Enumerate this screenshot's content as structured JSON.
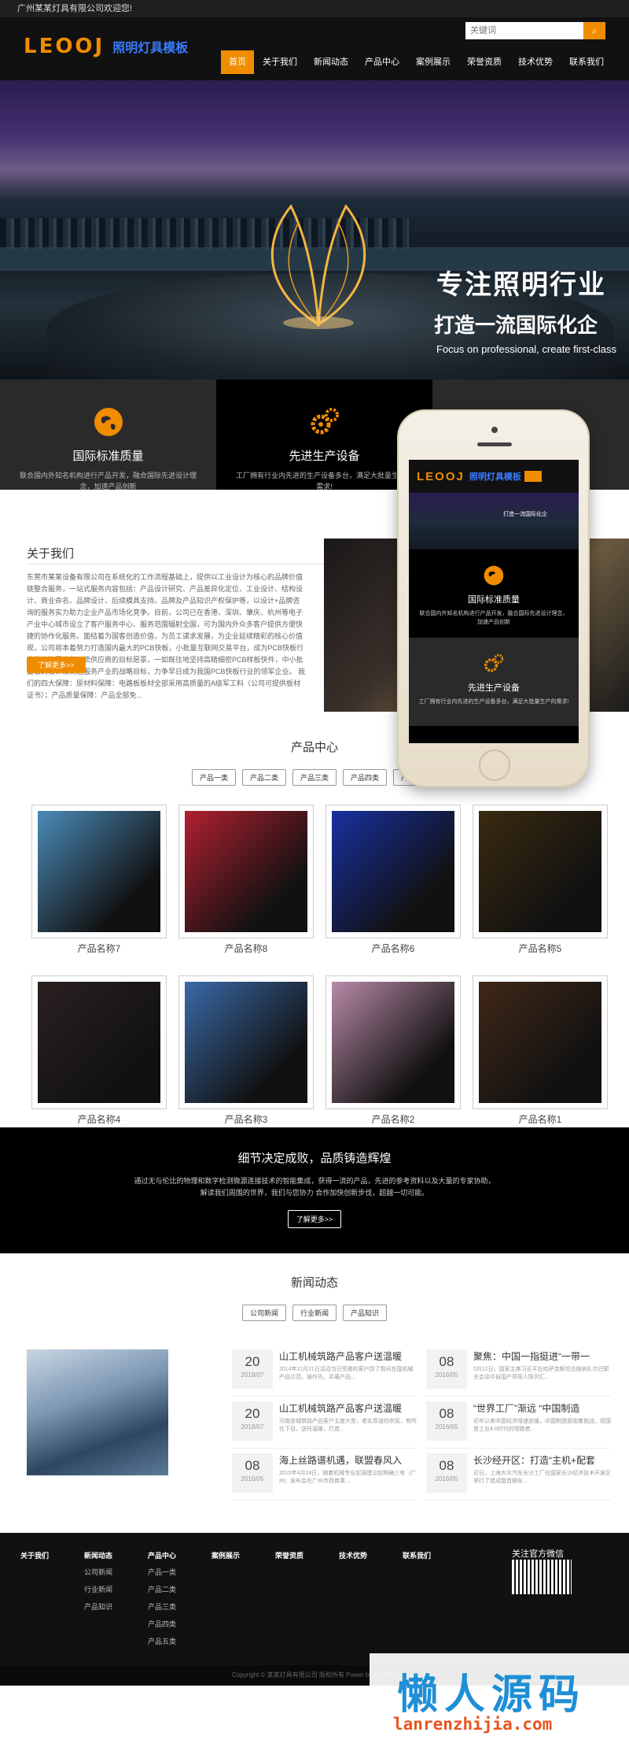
{
  "topbar": {
    "welcome": "广州某某灯具有限公司欢迎您!"
  },
  "header": {
    "logo_mark": "LEOOJ",
    "logo_text": "照明灯具模板",
    "search_placeholder": "关键词",
    "search_icon": "search-icon",
    "nav": [
      "首页",
      "关于我们",
      "新闻动态",
      "产品中心",
      "案例展示",
      "荣誉资质",
      "技术优势",
      "联系我们"
    ],
    "active_nav": "首页"
  },
  "banner": {
    "line1": "专注照明行业",
    "line2": "打造一流国际化企",
    "line3": "Focus on professional, create first-class"
  },
  "features": [
    {
      "title": "国际标准质量",
      "desc": "联合国内外知名机构进行产品开发，融合国际先进设计理念，加速产品创新",
      "icon": "globe-icon"
    },
    {
      "title": "先进生产设备",
      "desc": "工厂拥有行业内先进的生产设备多台，满足大批量生产的需求!",
      "icon": "gears-icon"
    },
    {
      "title": "",
      "desc": "",
      "icon": ""
    }
  ],
  "about": {
    "title": "关于我们",
    "text": "东莞市某某设备有限公司在系统化的工作流程基础上，提供以工业设计为核心的品牌价值链整合服务，一站式服务内容包括：产品设计研究、产品差异化定位、工业设计、结构设计、商业命名、品牌设计、后续模具支持。品牌及产品知识产权保护等，以设计+品牌咨询的服务实力助力企业产品市场化竞争。目前，公司已在香港、深圳、肇庆、杭州等电子产业中心城市设立了客户服务中心、服务范围辐射全国，可为国内外众多客户提供方便快捷的协作化服务。面结着为国客创造价值，为员工谋求发展，为企业延续精彩的核心价值观，公司将本着努力打造国内最大的PCB快板，小批量互联网交易平台，成为PCB快板行业性价比最高的一流供应商的目标愿景，一如既往地坚持高精细密PCB样板快件，中小批量板的设计及制造服务产业的战略目标，力争早日成为我国PCB快板行业的领军企业。 我们的四大保障：原材料保障：电路板板材全部采用高质量的A级军工料（公司可提供板材证书）；产品质量保障：产品全部免...",
    "more": "了解更多>>"
  },
  "phone": {
    "logo_mark": "LEOOJ",
    "logo_text": "照明灯具模板",
    "banner_text": "打造一流国际化企",
    "features": [
      {
        "title": "国际标准质量",
        "desc": "联合国内外知名机构进行产品开发，融合国际先进设计理念，加速产品创新"
      },
      {
        "title": "先进生产设备",
        "desc": "工厂拥有行业内先进的生产设备多台，满足大批量生产的需求!"
      }
    ]
  },
  "products": {
    "title": "产品中心",
    "tabs": [
      "产品一类",
      "产品二类",
      "产品三类",
      "产品四类",
      "产品五类"
    ],
    "items": [
      {
        "name": "产品名称7",
        "tone": "#4a8bb8"
      },
      {
        "name": "产品名称8",
        "tone": "#b02030"
      },
      {
        "name": "产品名称6",
        "tone": "#1830a0"
      },
      {
        "name": "产品名称5",
        "tone": "#3a2a10"
      },
      {
        "name": "产品名称4",
        "tone": "#2a2020"
      },
      {
        "name": "产品名称3",
        "tone": "#3a6aa8"
      },
      {
        "name": "产品名称2",
        "tone": "#b88aa8"
      },
      {
        "name": "产品名称1",
        "tone": "#402818"
      }
    ]
  },
  "culture": {
    "title": "细节决定成败，品质铸造辉煌",
    "text": "通过无与伦比的物理和数字检测微源连接技术的智能集成，获得一流的产品，先进的参考资料以及大量的专家协助，解读我们周围的世界，我们与您协力 合作加快创新步伐，超越一切可能。",
    "more": "了解更多>>"
  },
  "news": {
    "title": "新闻动态",
    "tabs": [
      "公司新闻",
      "行业新闻",
      "产品知识"
    ],
    "left": [
      {
        "day": "20",
        "ym": "2018/07",
        "title": "山工机械筑路产品客户送温暖",
        "summary": "2014年11月21日活动当日受邀的客户到了我司在国机械产品示范，操作先，并展产品..."
      },
      {
        "day": "20",
        "ym": "2018/07",
        "title": "山工机械筑路产品客户送温暖",
        "summary": "河南浙城筑路产品客户主度大型，老实厚道的农民，有所在下目，送托温暖，打造..."
      },
      {
        "day": "08",
        "ym": "2016/05",
        "title": "海上丝路谱机遇，联盟春风入",
        "summary": "2015年4月24日，随着机械专业起源建议起明确三有（广州）发布会在广州市西商事..."
      }
    ],
    "right": [
      {
        "day": "08",
        "ym": "2016/05",
        "title": "聚焦：中国一指挺进“一带一",
        "summary": "5月12日，国家主席习近平在哈萨克斯坦总统纳扎尔巴耶夫会谈中自国产领导人陈列汇..."
      },
      {
        "day": "08",
        "ym": "2016/05",
        "title": "“世界工厂”渐远 “中国制造",
        "summary": "近年以来中国经济增速放缓，中国制造面临着挑战，德国是工业4.0时代的领跑者..."
      },
      {
        "day": "08",
        "ym": "2016/05",
        "title": "长沙经开区：打造“主机+配套",
        "summary": "近日，上海大众汽车长沙工厂在国家长沙经济技术开发区举行了建成暨首辆车..."
      }
    ]
  },
  "footer": {
    "cols": [
      {
        "head": "关于我们",
        "links": []
      },
      {
        "head": "新闻动态",
        "links": [
          "公司新闻",
          "行业新闻",
          "产品知识"
        ]
      },
      {
        "head": "产品中心",
        "links": [
          "产品一类",
          "产品二类",
          "产品三类",
          "产品四类",
          "产品五类"
        ]
      },
      {
        "head": "案例展示",
        "links": []
      },
      {
        "head": "荣誉资质",
        "links": []
      },
      {
        "head": "技术优势",
        "links": []
      },
      {
        "head": "联系我们",
        "links": []
      }
    ],
    "qr_title": "关注官方微信",
    "copyright": "Copyright © 某某灯具有限公司 版权所有 Power by DeDe58"
  },
  "watermark": {
    "cn": "懒人源码",
    "en": "lanrenzhijia.com"
  },
  "colors": {
    "accent": "#f08c00",
    "brand_blue": "#3a7cff",
    "dark": "#111111"
  }
}
